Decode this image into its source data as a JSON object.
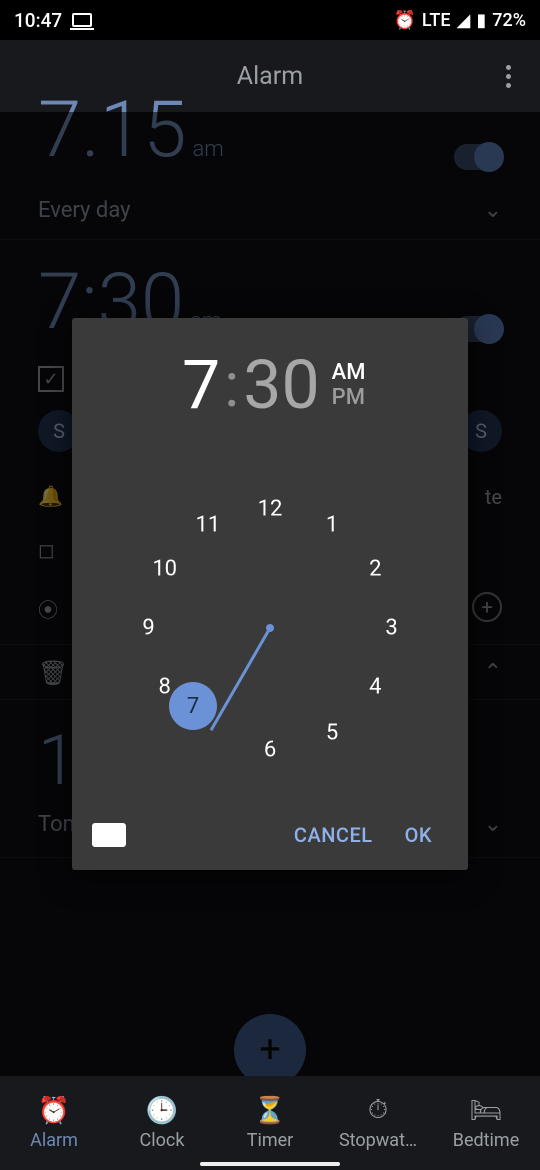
{
  "status": {
    "time": "10:47",
    "network": "LTE",
    "battery": "72%"
  },
  "header": {
    "title": "Alarm"
  },
  "alarm1": {
    "time": "7.15",
    "ampm": "am",
    "repeat": "Every day"
  },
  "alarm2": {
    "time": "7:30",
    "ampm": "am"
  },
  "alarm3": {
    "time_partial": "1",
    "repeat": "Tomorrow"
  },
  "option_vibrate_trail": "te",
  "day_chip_s1": "S",
  "day_chip_s2": "S",
  "picker": {
    "hour": "7",
    "minute": "30",
    "am": "AM",
    "pm": "PM",
    "cancel": "CANCEL",
    "ok": "OK",
    "numbers": [
      "12",
      "1",
      "2",
      "3",
      "4",
      "5",
      "6",
      "7",
      "8",
      "9",
      "10",
      "11"
    ]
  },
  "nav": {
    "alarm": "Alarm",
    "clock": "Clock",
    "timer": "Timer",
    "stopwatch": "Stopwat…",
    "bedtime": "Bedtime"
  },
  "fab_plus": "+"
}
